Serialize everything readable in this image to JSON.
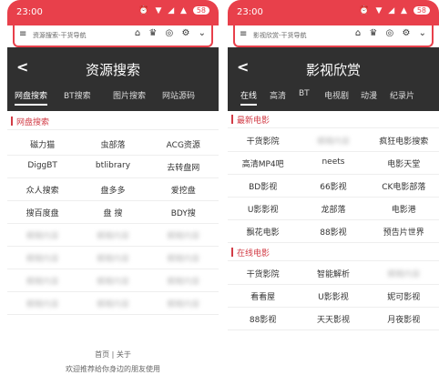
{
  "left": {
    "status": {
      "time": "23:00",
      "battery": "58"
    },
    "toolbar": {
      "address": "资源搜索-干货导航"
    },
    "header": {
      "back": "<",
      "title": "资源搜索"
    },
    "tabs": [
      "网盘搜索",
      "BT搜索",
      "图片搜索",
      "网站源码"
    ],
    "section": "网盘搜索",
    "rows": [
      [
        "磁力猫",
        "虫部落",
        "ACG资源"
      ],
      [
        "DiggBT",
        "btlibrary",
        "去转盘网"
      ],
      [
        "众人搜索",
        "盘多多",
        "爱挖盘"
      ],
      [
        "搜百度盘",
        "盘 搜",
        "BDY搜"
      ],
      [
        "模糊内容",
        "模糊内容",
        "模糊内容"
      ],
      [
        "模糊内容",
        "模糊内容",
        "模糊内容"
      ],
      [
        "模糊内容",
        "模糊内容",
        "模糊内容"
      ],
      [
        "模糊内容",
        "模糊内容",
        "模糊内容"
      ]
    ],
    "footer": {
      "links": "首页 | 关于",
      "text": "欢迎推荐给你身边的朋友使用"
    }
  },
  "right": {
    "status": {
      "time": "23:00",
      "battery": "58"
    },
    "toolbar": {
      "address": "影视欣赏-干货导航"
    },
    "header": {
      "back": "<",
      "title": "影视欣赏"
    },
    "tabs": [
      "在线",
      "高清",
      "BT",
      "电视剧",
      "动漫",
      "纪录片"
    ],
    "section1": "最新电影",
    "rows1": [
      [
        "干货影院",
        "模糊内容",
        "疯狂电影搜索"
      ],
      [
        "高清MP4吧",
        "neets",
        "电影天堂"
      ],
      [
        "BD影视",
        "66影视",
        "CK电影部落"
      ],
      [
        "U影影视",
        "龙部落",
        "电影港"
      ],
      [
        "飘花电影",
        "88影视",
        "预告片世界"
      ]
    ],
    "section2": "在线电影",
    "rows2": [
      [
        "干货影院",
        "智能解析",
        "模糊内容"
      ],
      [
        "看看屋",
        "U影影视",
        "妮可影视"
      ],
      [
        "88影视",
        "天天影视",
        "月夜影视"
      ]
    ]
  },
  "colors": {
    "accent": "#e8404b",
    "header_bg": "#303030",
    "section_red": "#d23c46"
  }
}
